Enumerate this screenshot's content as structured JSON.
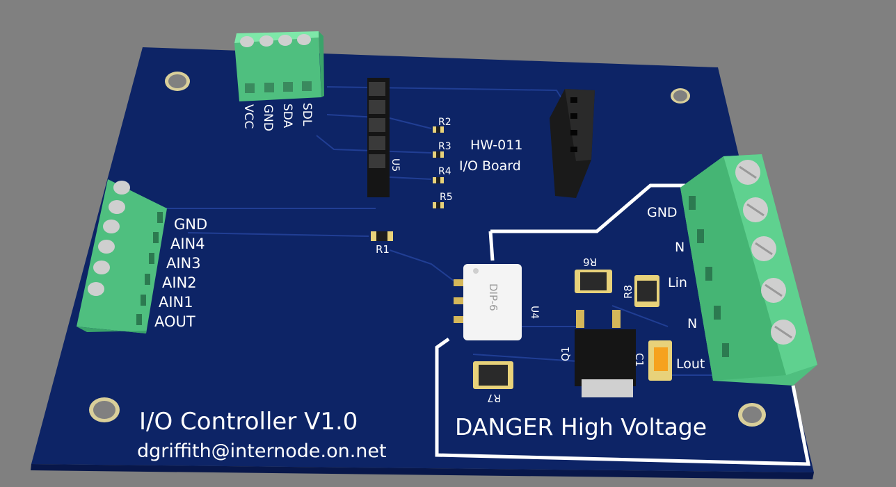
{
  "colors": {
    "background": "#808080",
    "board": "#0d2466",
    "silkscreen": "#ffffff",
    "terminal_block": "#5fd18f",
    "header": "#1a1a1a",
    "ic_body": "#f4f4f4"
  },
  "board": {
    "title": "I/O Controller V1.0",
    "email": "dgriffith@internode.on.net",
    "danger_text": "DANGER High Voltage"
  },
  "top_connector": {
    "pins": [
      "VCC",
      "GND",
      "SDA",
      "SDL"
    ]
  },
  "left_connector": {
    "pins": [
      "GND",
      "AIN4",
      "AIN3",
      "AIN2",
      "AIN1",
      "AOUT"
    ]
  },
  "right_connector": {
    "pins": [
      "GND",
      "N",
      "Lin",
      "N",
      "Lout"
    ]
  },
  "module": {
    "line1": "HW-011",
    "line2": "I/O Board"
  },
  "designators": {
    "u5": "U5",
    "u4": "U4",
    "u4_body": "DIP-6",
    "r1": "R1",
    "r2": "R2",
    "r3": "R3",
    "r4": "R4",
    "r5": "R5",
    "r6": "R6",
    "r7": "R7",
    "r8": "R8",
    "q1": "Q1",
    "c1": "C1"
  }
}
